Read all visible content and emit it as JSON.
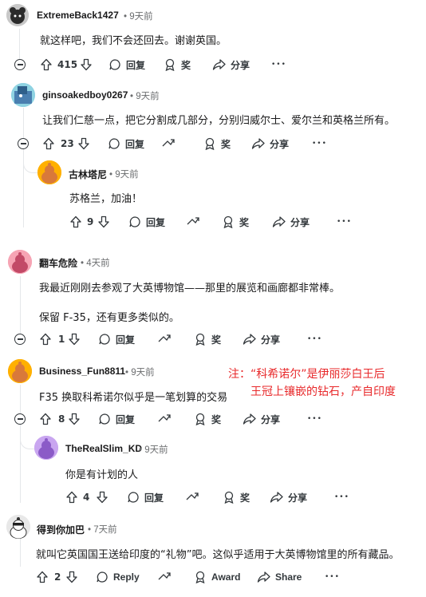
{
  "comments": [
    {
      "username": "ExtremeBack1427",
      "time": "9天前",
      "lines": [
        "就这样吧，我们不会还回去。谢谢英国。"
      ],
      "votes": "415",
      "reply": "回复",
      "award": "奖",
      "share": "分享",
      "more": "•••"
    },
    {
      "username": "ginsoakedboy0267",
      "time": "9天前",
      "lines": [
        "让我们仁慈一点，把它分割成几部分，分别归威尔士、爱尔兰和英格兰所有。"
      ],
      "votes": "23",
      "reply": "回复",
      "award": "奖",
      "share": "分享",
      "more": "•••"
    },
    {
      "username": "古林塔尼",
      "time": "9天前",
      "lines": [
        "苏格兰，加油！"
      ],
      "votes": "9",
      "reply": "回复",
      "award": "奖",
      "share": "分享",
      "more": "•••"
    },
    {
      "username": "翻车危险",
      "time": "4天前",
      "lines": [
        "我最近刚刚去参观了大英博物馆——那里的展览和画廊都非常棒。",
        "保留 F-35，还有更多类似的。"
      ],
      "votes": "1",
      "reply": "回复",
      "award": "奖",
      "share": "分享",
      "more": "•••"
    },
    {
      "username": "Business_Fun8811",
      "time": "9天前",
      "lines": [
        "F35 换取科希诺尔似乎是一笔划算的交易"
      ],
      "votes": "8",
      "reply": "回复",
      "award": "奖",
      "share": "分享",
      "more": "•••"
    },
    {
      "username": "TheRealSlim_KD",
      "time": "9天前",
      "lines": [
        "你是有计划的人"
      ],
      "votes": "4",
      "reply": "回复",
      "award": "奖",
      "share": "分享",
      "more": "•••"
    },
    {
      "username": "得到你加巴",
      "time": "7天前",
      "lines": [
        "就叫它英国国王送给印度的“礼物”吧。这似乎适用于大英博物馆里的所有藏品。"
      ],
      "votes": "2",
      "reply": "Reply",
      "award": "Award",
      "share": "Share",
      "more": "•••"
    }
  ],
  "annotation": {
    "line1": "注：“科希诺尔”是伊丽莎白王后",
    "line2": "王冠上镶嵌的钻石，产自印度"
  },
  "colors": {
    "accent_annotation": "#e8292b",
    "text": "#1a1a1b",
    "meta": "#6a6c6e",
    "line": "#e5e7ea"
  }
}
